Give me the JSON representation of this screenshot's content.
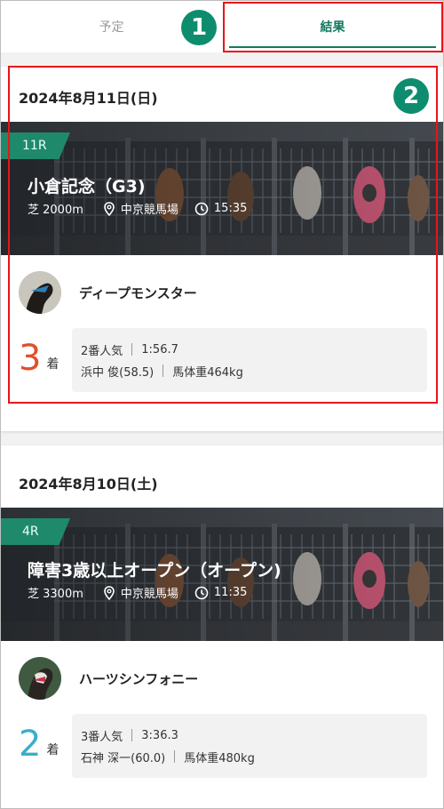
{
  "tabs": [
    {
      "label": "予定",
      "active": false
    },
    {
      "label": "結果",
      "active": true
    }
  ],
  "markers": [
    "1",
    "2"
  ],
  "results": [
    {
      "date": "2024年8月11日(日)",
      "race_number": "11R",
      "race_name": "小倉記念（G3)",
      "course": "芝 2000m",
      "venue": "中京競馬場",
      "time": "15:35",
      "horse_name": "ディープモンスター",
      "place": "3",
      "place_suffix": "着",
      "place_color": "#e0502a",
      "popularity": "2番人気",
      "finish_time": "1:56.7",
      "jockey": "浜中 俊(58.5)",
      "horse_weight": "馬体重464kg"
    },
    {
      "date": "2024年8月10日(土)",
      "race_number": "4R",
      "race_name": "障害3歳以上オープン（オープン)",
      "course": "芝 3300m",
      "venue": "中京競馬場",
      "time": "11:35",
      "horse_name": "ハーツシンフォニー",
      "place": "2",
      "place_suffix": "着",
      "place_color": "#3aaecb",
      "popularity": "3番人気",
      "finish_time": "3:36.3",
      "jockey": "石神 深一(60.0)",
      "horse_weight": "馬体重480kg"
    }
  ],
  "icons": {
    "location": "location-pin-icon",
    "clock": "clock-icon"
  }
}
